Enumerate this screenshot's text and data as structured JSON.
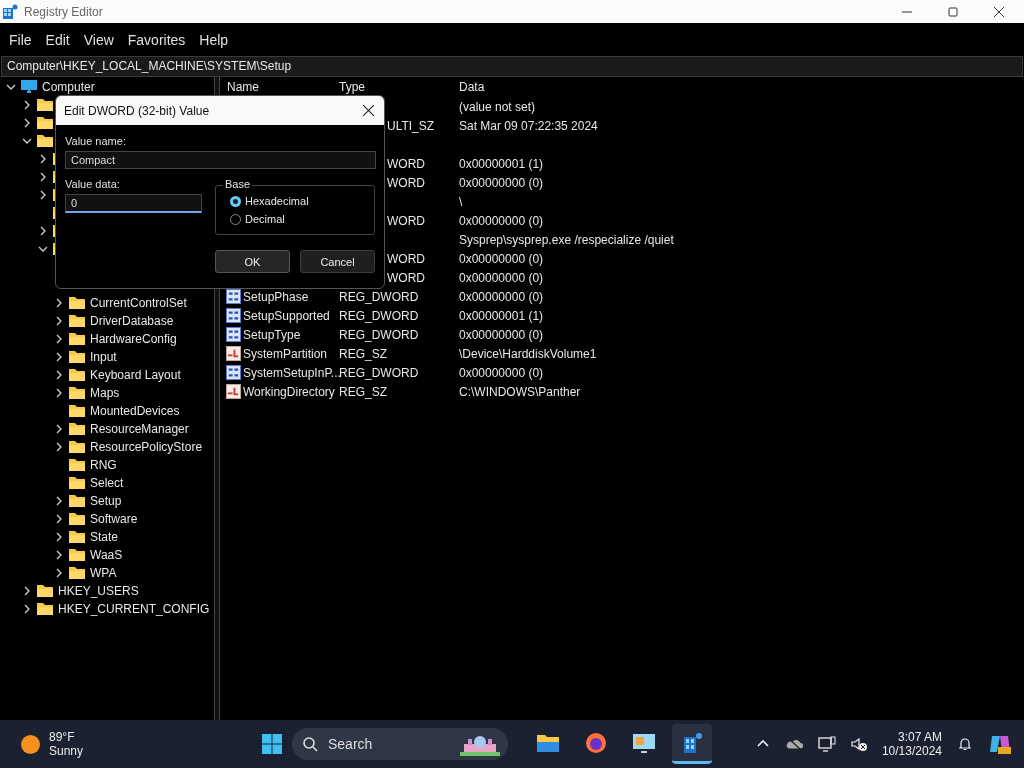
{
  "window": {
    "title": "Registry Editor"
  },
  "menu": [
    "File",
    "Edit",
    "View",
    "Favorites",
    "Help"
  ],
  "address": "Computer\\HKEY_LOCAL_MACHINE\\SYSTEM\\Setup",
  "tree": [
    {
      "label": "Computer",
      "kind": "computer",
      "expandable": true,
      "expanded": true,
      "children": [
        {
          "expandable": true,
          "expanded": false
        },
        {
          "expandable": true,
          "expanded": false
        },
        {
          "expandable": true,
          "expanded": true,
          "children": [
            {
              "expandable": true,
              "expanded": false
            },
            {
              "expandable": true,
              "expanded": false
            },
            {
              "expandable": true,
              "expanded": false
            },
            {
              "expandable": false,
              "expanded": false
            },
            {
              "expandable": true,
              "expanded": false
            },
            {
              "expandable": true,
              "expanded": true,
              "children": [
                {
                  "label": "CurrentControlSet",
                  "expandable": true,
                  "expanded": false
                },
                {
                  "label": "DriverDatabase",
                  "expandable": true,
                  "expanded": false
                },
                {
                  "label": "HardwareConfig",
                  "expandable": true,
                  "expanded": false
                },
                {
                  "label": "Input",
                  "expandable": true,
                  "expanded": false
                },
                {
                  "label": "Keyboard Layout",
                  "expandable": true,
                  "expanded": false
                },
                {
                  "label": "Maps",
                  "expandable": true,
                  "expanded": false
                },
                {
                  "label": "MountedDevices",
                  "expandable": false,
                  "expanded": false
                },
                {
                  "label": "ResourceManager",
                  "expandable": true,
                  "expanded": false
                },
                {
                  "label": "ResourcePolicyStore",
                  "expandable": true,
                  "expanded": false
                },
                {
                  "label": "RNG",
                  "expandable": false,
                  "expanded": false
                },
                {
                  "label": "Select",
                  "expandable": false,
                  "expanded": false
                },
                {
                  "label": "Setup",
                  "expandable": true,
                  "expanded": false
                },
                {
                  "label": "Software",
                  "expandable": true,
                  "expanded": false
                },
                {
                  "label": "State",
                  "expandable": true,
                  "expanded": false
                },
                {
                  "label": "WaaS",
                  "expandable": true,
                  "expanded": false
                },
                {
                  "label": "WPA",
                  "expandable": true,
                  "expanded": false
                }
              ]
            }
          ]
        },
        {
          "label": "HKEY_USERS",
          "expandable": true,
          "expanded": false
        },
        {
          "label": "HKEY_CURRENT_CONFIG",
          "expandable": true,
          "expanded": false
        }
      ]
    }
  ],
  "values": {
    "columns": [
      "Name",
      "Type",
      "Data"
    ],
    "rows": [
      {
        "data": "(value not set)"
      },
      {
        "type": "ULTI_SZ",
        "data": "Sat Mar 09 07:22:35 2024"
      },
      {},
      {
        "type": "WORD",
        "data": "0x00000001 (1)"
      },
      {
        "type": "WORD",
        "data": "0x00000000 (0)"
      },
      {
        "data": "\\"
      },
      {
        "type": "WORD",
        "data": "0x00000000 (0)"
      },
      {
        "data": "Sysprep\\sysprep.exe /respecialize /quiet"
      },
      {
        "type": "WORD",
        "data": "0x00000000 (0)"
      },
      {
        "type": "WORD",
        "data": "0x00000000 (0)"
      },
      {
        "name": "SetupPhase",
        "kind": "binary",
        "type": "REG_DWORD",
        "data": "0x00000000 (0)"
      },
      {
        "name": "SetupSupported",
        "kind": "binary",
        "type": "REG_DWORD",
        "data": "0x00000001 (1)"
      },
      {
        "name": "SetupType",
        "kind": "binary",
        "type": "REG_DWORD",
        "data": "0x00000000 (0)"
      },
      {
        "name": "SystemPartition",
        "kind": "string",
        "type": "REG_SZ",
        "data": "\\Device\\HarddiskVolume1"
      },
      {
        "name": "SystemSetupInP...",
        "kind": "binary",
        "type": "REG_DWORD",
        "data": "0x00000000 (0)"
      },
      {
        "name": "WorkingDirectory",
        "kind": "string",
        "type": "REG_SZ",
        "data": "C:\\WINDOWS\\Panther"
      }
    ]
  },
  "dialog": {
    "title": "Edit DWORD (32-bit) Value",
    "name_label": "Value name:",
    "name_value": "Compact",
    "data_label": "Value data:",
    "data_value": "0",
    "base_label": "Base",
    "bases": [
      {
        "label": "Hexadecimal",
        "selected": true
      },
      {
        "label": "Decimal",
        "selected": false
      }
    ],
    "buttons": [
      "OK",
      "Cancel"
    ]
  },
  "taskbar": {
    "weather": {
      "temp": "89°F",
      "condition": "Sunny"
    },
    "search": {
      "placeholder": "Search"
    },
    "apps": [
      {
        "kind": "folder",
        "selected": false
      },
      {
        "kind": "browser",
        "selected": false
      },
      {
        "kind": "remote",
        "selected": false
      },
      {
        "kind": "registry",
        "selected": true
      }
    ],
    "time": "3:07 AM",
    "date": "10/13/2024"
  }
}
